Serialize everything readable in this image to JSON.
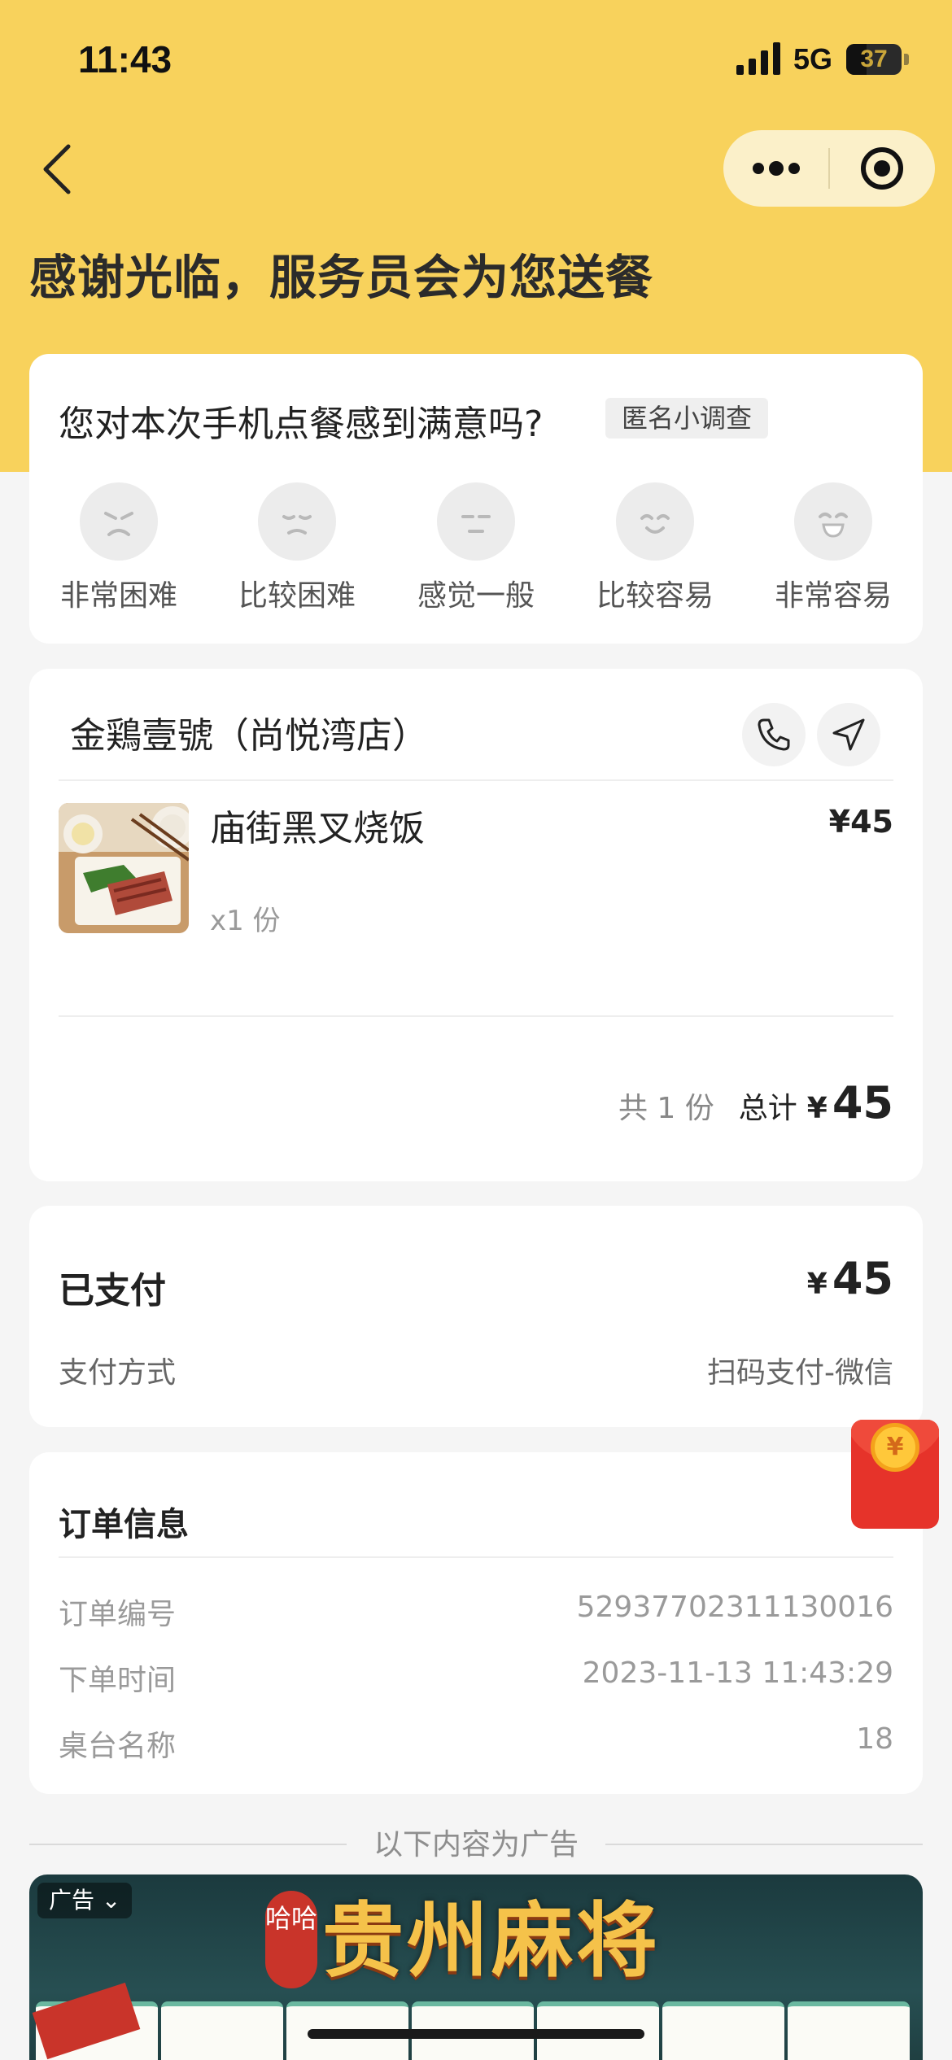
{
  "status_bar": {
    "time": "11:43",
    "network": "5G",
    "battery": "37",
    "battery_level": 0.37
  },
  "hero": {
    "title": "感谢光临，服务员会为您送餐"
  },
  "nav": {
    "back_icon": "chevron-left-icon",
    "more_icon": "more-dots-icon",
    "close_icon": "target-circle-icon"
  },
  "survey": {
    "question": "您对本次手机点餐感到满意吗?",
    "tag": "匿名小调查",
    "options": [
      {
        "label": "非常困难",
        "icon": "angry-face-icon"
      },
      {
        "label": "比较困难",
        "icon": "sad-face-icon"
      },
      {
        "label": "感觉一般",
        "icon": "neutral-face-icon"
      },
      {
        "label": "比较容易",
        "icon": "smile-face-icon"
      },
      {
        "label": "非常容易",
        "icon": "laugh-face-icon"
      }
    ]
  },
  "store": {
    "name": "金鶏壹號（尚悦湾店）",
    "call_icon": "phone-icon",
    "nav_icon": "navigation-arrow-icon",
    "item": {
      "name": "庙街黑叉烧饭",
      "price": "¥45",
      "qty": "x1 份"
    },
    "summary": {
      "count": "共 1 份",
      "total_label": "总计",
      "currency": "¥",
      "total": "45"
    }
  },
  "payment": {
    "title": "已支付",
    "currency": "¥",
    "amount": "45",
    "method_label": "支付方式",
    "method_value": "扫码支付-微信"
  },
  "red_packet": {
    "symbol": "¥"
  },
  "order_info": {
    "title": "订单信息",
    "rows": [
      {
        "label": "订单编号",
        "value": "52937702311130016"
      },
      {
        "label": "下单时间",
        "value": "2023-11-13 11:43:29"
      },
      {
        "label": "桌台名称",
        "value": "18"
      }
    ]
  },
  "ad": {
    "divider_text": "以下内容为广告",
    "tag": "广告 ⌄",
    "badge": "哈哈",
    "title": "贵州麻将"
  },
  "colors": {
    "hero_bg": "#f8d25c",
    "page_bg": "#f5f5f5",
    "card_bg": "#ffffff",
    "red_packet": "#e6332a"
  }
}
